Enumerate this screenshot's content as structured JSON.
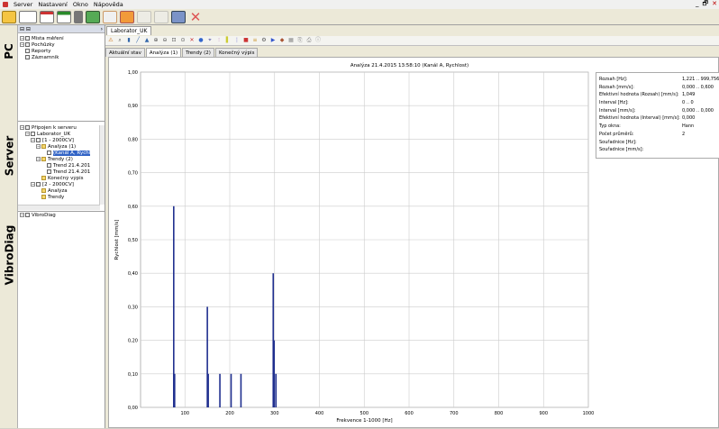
{
  "menubar": {
    "items": [
      "Server",
      "Nastavení",
      "Okno",
      "Nápověda"
    ],
    "window_controls": [
      "_",
      "🗗",
      "✕"
    ]
  },
  "toolbar": {
    "icons": [
      "folder-open-icon",
      "folder-dropdown-icon",
      "grid-icon",
      "grid-add-icon",
      "device-icon",
      "device-add-icon",
      "document-add-icon",
      "email-icon",
      "columns-icon",
      "blank-icon",
      "save-icon",
      "delete-icon"
    ]
  },
  "left_rail": {
    "labels": [
      "PC",
      "Server",
      "VibroDiag"
    ]
  },
  "panel": {
    "header_left": "⊟ ⊟",
    "header_right": "›",
    "pc_tree": [
      {
        "label": "Místa měření",
        "level": 0,
        "expandable": true
      },
      {
        "label": "Pochůzky",
        "level": 0,
        "expandable": true
      },
      {
        "label": "Reporty",
        "level": 0,
        "expandable": false
      },
      {
        "label": "Záznamník",
        "level": 0,
        "expandable": false
      }
    ],
    "server_tree": [
      {
        "label": "Připojen k serveru",
        "level": 0,
        "expandable": true
      },
      {
        "label": "Laborator_UK",
        "level": 1,
        "expandable": true
      },
      {
        "label": "[1 - 2000CV]",
        "level": 2,
        "expandable": true
      },
      {
        "label": "Analýza (1)",
        "level": 3,
        "expandable": true
      },
      {
        "label": "(Kanál A, Rychl",
        "level": 4,
        "expandable": false,
        "selected": true
      },
      {
        "label": "Trendy (2)",
        "level": 3,
        "expandable": true
      },
      {
        "label": "Trend 21.4.201",
        "level": 4,
        "expandable": false
      },
      {
        "label": "Trend 21.4.201",
        "level": 4,
        "expandable": false
      },
      {
        "label": "Konečný výpis",
        "level": 3,
        "expandable": false
      },
      {
        "label": "[2 - 2000CV]",
        "level": 2,
        "expandable": true
      },
      {
        "label": "Analýza",
        "level": 3,
        "expandable": false
      },
      {
        "label": "Trendy",
        "level": 3,
        "expandable": false
      }
    ],
    "vibro_tree": [
      {
        "label": "VibroDiag",
        "level": 0,
        "expandable": true
      }
    ]
  },
  "main": {
    "doc_tab": "Laborator_UK",
    "subtabs": [
      "Aktuální stav",
      "Analýza (1)",
      "Trendy (2)",
      "Konečný výpis"
    ],
    "active_subtab": 1
  },
  "chart_data": {
    "type": "bar",
    "title": "Analýza 21.4.2015 13:58:10 (Kanál A, Rychlost)",
    "xlabel": "Frekvence 1-1000 [Hz]",
    "ylabel": "Rychlost [mm/s]",
    "xlim": [
      1,
      1000
    ],
    "ylim": [
      0,
      1.0
    ],
    "x_ticks": [
      100,
      200,
      300,
      400,
      500,
      600,
      700,
      800,
      900,
      1000
    ],
    "y_ticks": [
      "0,00",
      "0,10",
      "0,20",
      "0,30",
      "0,40",
      "0,50",
      "0,60",
      "0,70",
      "0,80",
      "0,90",
      "1,00"
    ],
    "grid": true,
    "color": "#1f2f8f",
    "points": [
      {
        "x": 75,
        "y": 0.6
      },
      {
        "x": 77,
        "y": 0.1
      },
      {
        "x": 150,
        "y": 0.3
      },
      {
        "x": 152,
        "y": 0.1
      },
      {
        "x": 178,
        "y": 0.1
      },
      {
        "x": 203,
        "y": 0.1
      },
      {
        "x": 225,
        "y": 0.1
      },
      {
        "x": 297,
        "y": 0.4
      },
      {
        "x": 299,
        "y": 0.2
      },
      {
        "x": 303,
        "y": 0.1
      }
    ]
  },
  "info": [
    {
      "label": "Rozsah [Hz]:",
      "value": "1,221 .. 999,756"
    },
    {
      "label": "Rozsah [mm/s]:",
      "value": "0,000 .. 0,600"
    },
    {
      "label": "Efektivní hodnota (Rozsah) [mm/s]:",
      "value": "1,049"
    },
    {
      "label": "Interval [Hz]:",
      "value": "0 .. 0"
    },
    {
      "label": "Interval [mm/s]:",
      "value": "0,000 .. 0,000"
    },
    {
      "label": "Efektivní hodnota (Interval) [mm/s]:",
      "value": "0,000"
    },
    {
      "label": "Typ okna:",
      "value": "Hann"
    },
    {
      "label": "Počet průměrů:",
      "value": "2"
    },
    {
      "label": "Souřadnice [Hz]:",
      "value": ""
    },
    {
      "label": "Souřadnice [mm/s]:",
      "value": ""
    }
  ]
}
